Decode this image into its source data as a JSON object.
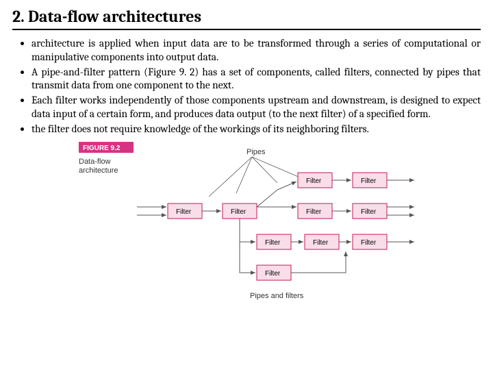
{
  "title": "2. Data-flow architectures",
  "bullets": [
    "architecture is applied when input data are to be transformed through a series of computational or manipulative components into output data.",
    "A pipe-and-filter pattern (Figure 9. 2) has a set of components, called filters, connected by pipes that transmit data from one component to the next.",
    "Each filter works independently of those components upstream and downstream, is designed to expect data input of a certain form, and produces data output (to the next filter) of a specified form.",
    "the filter does not require knowledge of the workings of its neighboring filters."
  ],
  "figure": {
    "label": "FIGURE 9.2",
    "caption1": "Data-flow",
    "caption2": "architecture",
    "pipes_label": "Pipes",
    "footer": "Pipes and filters",
    "box_label": "Filter",
    "colors": {
      "accent": "#d63384",
      "box_fill": "#f9dde8",
      "box_stroke": "#c2185b"
    }
  }
}
